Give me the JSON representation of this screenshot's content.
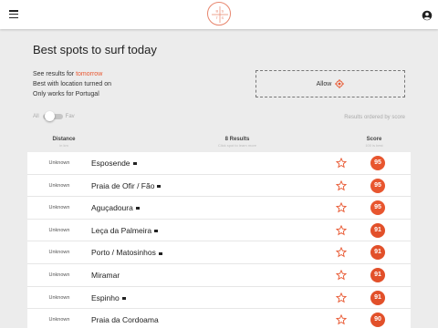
{
  "header": {
    "menu_icon": "hamburger-menu-icon",
    "logo_icon": "surf-logo-icon",
    "account_icon": "account-circle-icon"
  },
  "main": {
    "title": "Best spots to surf today",
    "info": {
      "see_results_prefix": "See results for ",
      "day_link": "tomorrow",
      "location_line": "Best with location turned on",
      "country_line": "Only works for Portugal"
    },
    "allow_button": {
      "label": "Allow",
      "icon": "location-target-icon"
    },
    "toggle": {
      "left_label": "All",
      "right_label": "Fav",
      "value": "All"
    },
    "order_note": "Results ordered by score"
  },
  "table": {
    "columns": {
      "distance": {
        "label": "Distance",
        "sub": "in km"
      },
      "results": {
        "label": "8 Results",
        "sub": "Click spot to learn more"
      },
      "score": {
        "label": "Score",
        "sub": "100 is best"
      }
    },
    "rows": [
      {
        "distance": "Unknown",
        "name": "Esposende",
        "flag": true,
        "score": "95"
      },
      {
        "distance": "Unknown",
        "name": "Praia de Ofir / Fão",
        "flag": true,
        "score": "95"
      },
      {
        "distance": "Unknown",
        "name": "Aguçadoura",
        "flag": true,
        "score": "95"
      },
      {
        "distance": "Unknown",
        "name": "Leça da Palmeira",
        "flag": true,
        "score": "91"
      },
      {
        "distance": "Unknown",
        "name": "Porto / Matosinhos",
        "flag": true,
        "score": "91"
      },
      {
        "distance": "Unknown",
        "name": "Miramar",
        "flag": false,
        "score": "91"
      },
      {
        "distance": "Unknown",
        "name": "Espinho",
        "flag": true,
        "score": "91"
      },
      {
        "distance": "Unknown",
        "name": "Praia da Cordoama",
        "flag": false,
        "score": "90"
      }
    ],
    "star_icon": "star-outline-icon",
    "flag_icon": "flag-icon"
  },
  "colors": {
    "accent": "#e8562f",
    "score_high": "#e8562f",
    "score_mid": "#e2502a",
    "background": "#ececec"
  }
}
